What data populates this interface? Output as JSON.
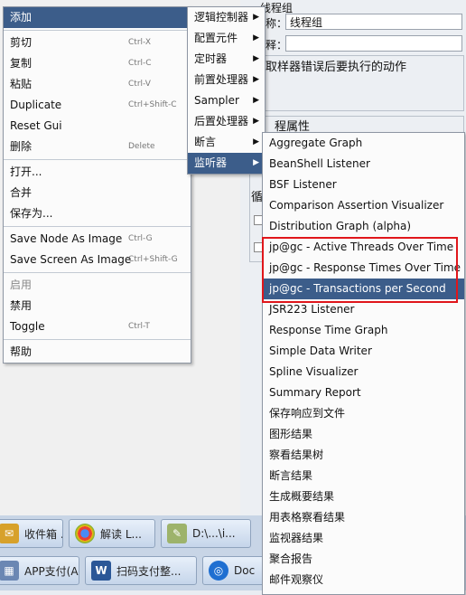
{
  "background": {
    "title_fragment": "线程组",
    "name_label": "称：",
    "name_value": "线程组",
    "comment_label": "释：",
    "on_error_label": "取样器错误后要执行的动作",
    "thread_props_label": "程属性",
    "partial_label": "循"
  },
  "context_menu": {
    "items": [
      {
        "label": "添加",
        "shortcut": ""
      },
      {
        "label": "剪切",
        "shortcut": "Ctrl-X"
      },
      {
        "label": "复制",
        "shortcut": "Ctrl-C"
      },
      {
        "label": "粘贴",
        "shortcut": "Ctrl-V"
      },
      {
        "label": "Duplicate",
        "shortcut": "Ctrl+Shift-C"
      },
      {
        "label": "Reset Gui",
        "shortcut": ""
      },
      {
        "label": "删除",
        "shortcut": "Delete"
      },
      {
        "label": "打开...",
        "shortcut": ""
      },
      {
        "label": "合并",
        "shortcut": ""
      },
      {
        "label": "保存为...",
        "shortcut": ""
      },
      {
        "label": "Save Node As Image",
        "shortcut": "Ctrl-G"
      },
      {
        "label": "Save Screen As Image",
        "shortcut": "Ctrl+Shift-G"
      },
      {
        "label": "启用",
        "shortcut": ""
      },
      {
        "label": "禁用",
        "shortcut": ""
      },
      {
        "label": "Toggle",
        "shortcut": "Ctrl-T"
      },
      {
        "label": "帮助",
        "shortcut": ""
      }
    ]
  },
  "add_submenu": {
    "items": [
      "逻辑控制器",
      "配置元件",
      "定时器",
      "前置处理器",
      "Sampler",
      "后置处理器",
      "断言",
      "监听器"
    ]
  },
  "listener_submenu": {
    "items": [
      "Aggregate Graph",
      "BeanShell Listener",
      "BSF Listener",
      "Comparison Assertion Visualizer",
      "Distribution Graph (alpha)",
      "jp@gc - Active Threads Over Time",
      "jp@gc - Response Times Over Time",
      "jp@gc - Transactions per Second",
      "JSR223 Listener",
      "Response Time Graph",
      "Simple Data Writer",
      "Spline Visualizer",
      "Summary Report",
      "保存响应到文件",
      "图形结果",
      "察看结果树",
      "断言结果",
      "生成概要结果",
      "用表格察看结果",
      "监视器结果",
      "聚合报告",
      "邮件观察仪"
    ]
  },
  "taskbar": {
    "row1": [
      "收件箱 ...",
      "解读 L...",
      "D:\\...\\i..."
    ],
    "row2": [
      "APP支付(A...",
      "扫码支付整...",
      "Doc"
    ]
  },
  "colors": {
    "highlight": "#3c5d8a",
    "annotation_box": "#e0161b"
  }
}
